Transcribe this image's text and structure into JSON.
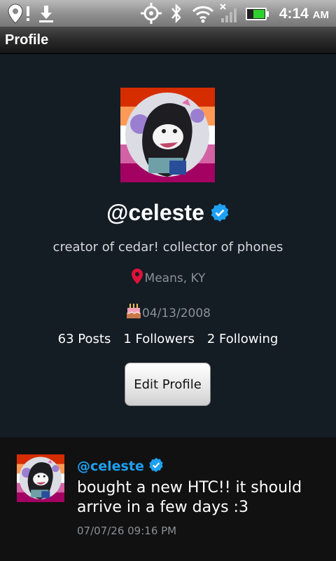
{
  "status_bar": {
    "time": "4:14",
    "ampm": "AM",
    "icons": [
      "location-alert-icon",
      "download-icon",
      "gps-icon",
      "bluetooth-icon",
      "wifi-icon",
      "no-signal-icon",
      "battery-icon"
    ]
  },
  "title_bar": {
    "title": "Profile"
  },
  "profile": {
    "handle": "@celeste",
    "verified": true,
    "bio": "creator of cedar! collector of phones",
    "location": "Means, KY",
    "birthday": "04/13/2008",
    "stats": {
      "posts": "63 Posts",
      "followers": "1 Followers",
      "following": "2 Following"
    },
    "edit_button": "Edit Profile",
    "flag_colors": [
      "#d52d00",
      "#ff9a56",
      "#ffffff",
      "#d362a4",
      "#a30262"
    ],
    "accent": "#1ea1f2"
  },
  "posts": [
    {
      "handle": "@celeste",
      "verified": true,
      "text": "bought a new HTC!! it should arrive in a few days :3",
      "timestamp": "07/07/26 09:16 PM"
    }
  ]
}
